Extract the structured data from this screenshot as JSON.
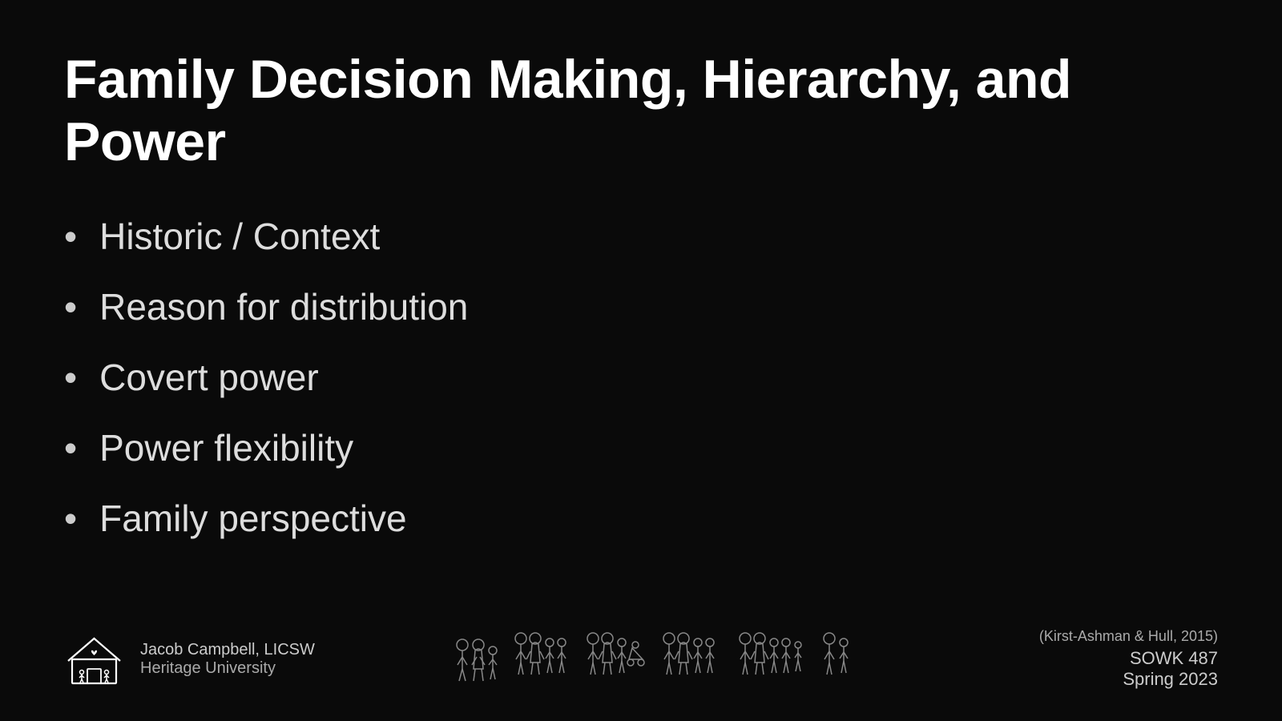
{
  "slide": {
    "title": "Family Decision Making, Hierarchy, and Power",
    "bullets": [
      "Historic / Context",
      "Reason for distribution",
      "Covert power",
      "Power flexibility",
      "Family perspective"
    ]
  },
  "footer": {
    "presenter_name": "Jacob Campbell, LICSW",
    "university": "Heritage University",
    "citation": "(Kirst-Ashman & Hull, 2015)",
    "course": "SOWK 487",
    "semester": "Spring 2023"
  }
}
